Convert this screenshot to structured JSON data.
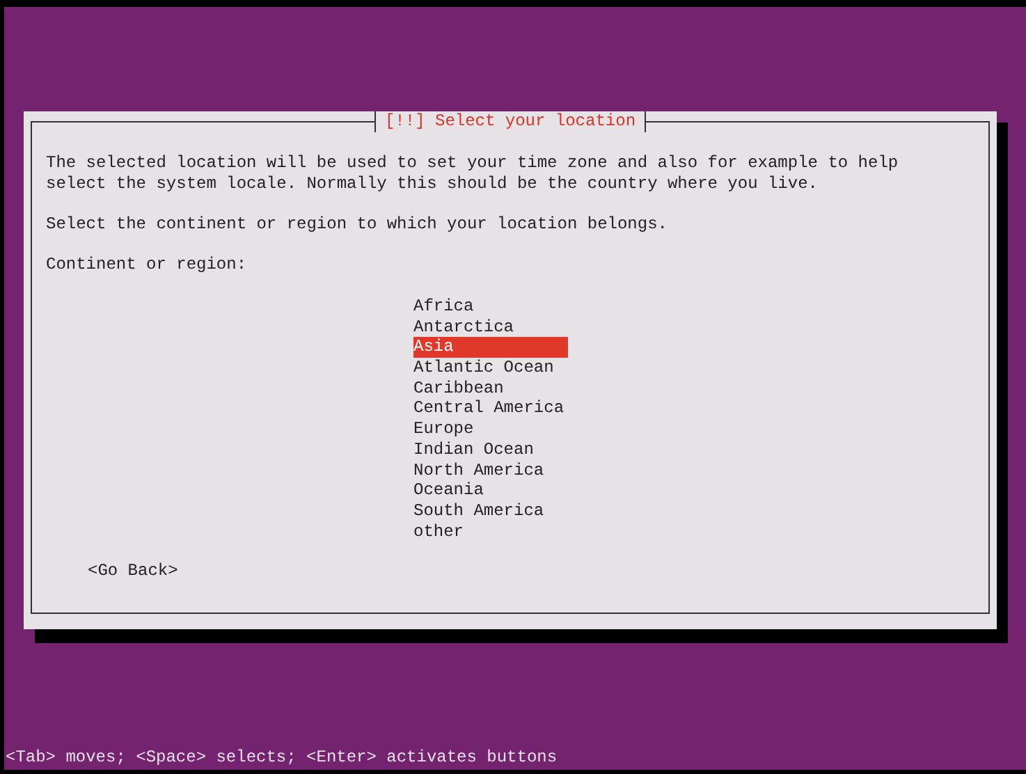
{
  "dialog": {
    "title": "[!!] Select your location",
    "description": "The selected location will be used to set your time zone and also for example to help select the system locale. Normally this should be the country where you live.",
    "prompt": "Select the continent or region to which your location belongs.",
    "label": "Continent or region:",
    "options": [
      {
        "label": "Africa",
        "selected": false
      },
      {
        "label": "Antarctica",
        "selected": false
      },
      {
        "label": "Asia",
        "selected": true
      },
      {
        "label": "Atlantic Ocean",
        "selected": false
      },
      {
        "label": "Caribbean",
        "selected": false
      },
      {
        "label": "Central America",
        "selected": false
      },
      {
        "label": "Europe",
        "selected": false
      },
      {
        "label": "Indian Ocean",
        "selected": false
      },
      {
        "label": "North America",
        "selected": false
      },
      {
        "label": "Oceania",
        "selected": false
      },
      {
        "label": "South America",
        "selected": false
      },
      {
        "label": "other",
        "selected": false
      }
    ],
    "back_button": "<Go Back>"
  },
  "status_bar": "<Tab> moves; <Space> selects; <Enter> activates buttons"
}
